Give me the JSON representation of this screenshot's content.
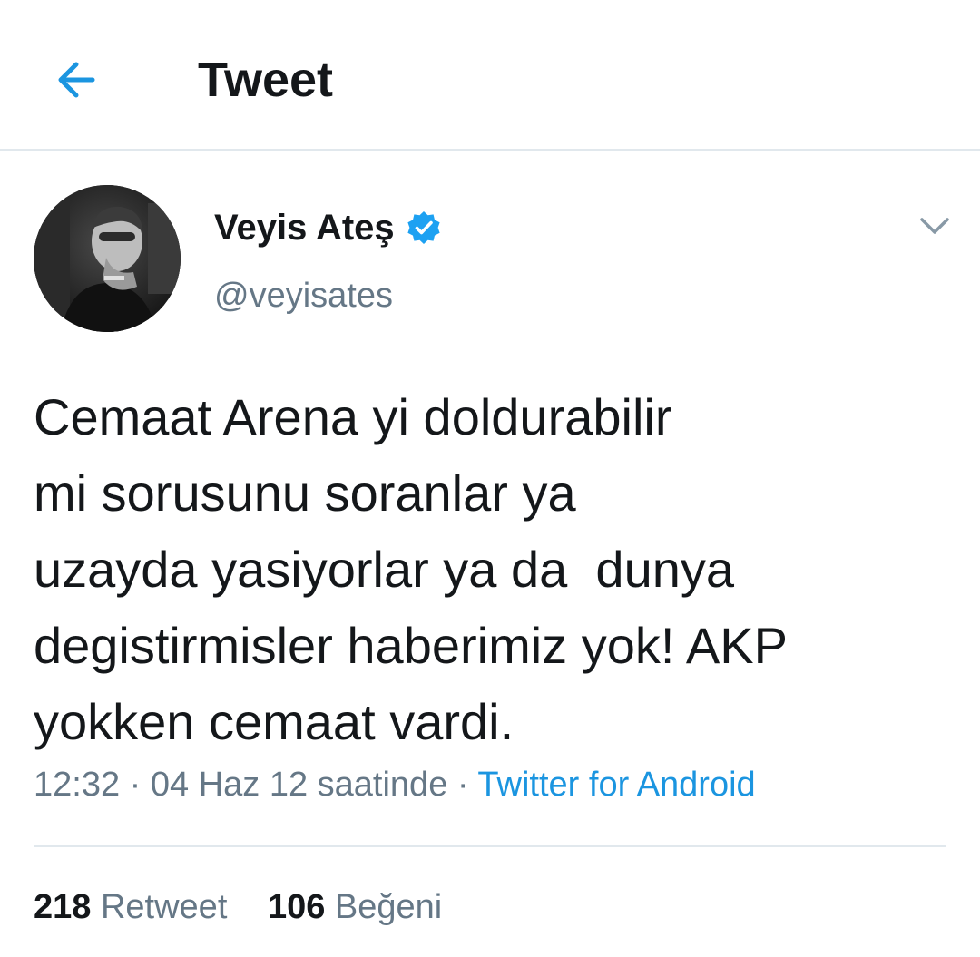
{
  "header": {
    "title": "Tweet",
    "back_icon": "arrow-left-icon"
  },
  "author": {
    "display_name": "Veyis Ateş",
    "handle": "@veyisates",
    "verified": true,
    "verified_icon": "verified-badge-icon",
    "avatar": "avatar-photo"
  },
  "tweet": {
    "text": "Cemaat Arena yi doldurabilir\nmi sorusunu soranlar ya\nuzayda yasiyorlar ya da  dunya\ndegistirmisler haberimiz yok! AKP\nyokken cemaat vardi.",
    "time": "12:32",
    "date": "04 Haz 12 saatinde",
    "separator": "·",
    "source": "Twitter for Android",
    "menu_icon": "chevron-down-icon"
  },
  "stats": {
    "retweets_count": "218",
    "retweets_label": "Retweet",
    "likes_count": "106",
    "likes_label": "Beğeni"
  },
  "colors": {
    "accent": "#1b95e0",
    "text_primary": "#14171a",
    "text_secondary": "#657786",
    "divider": "#e1e8ed"
  }
}
